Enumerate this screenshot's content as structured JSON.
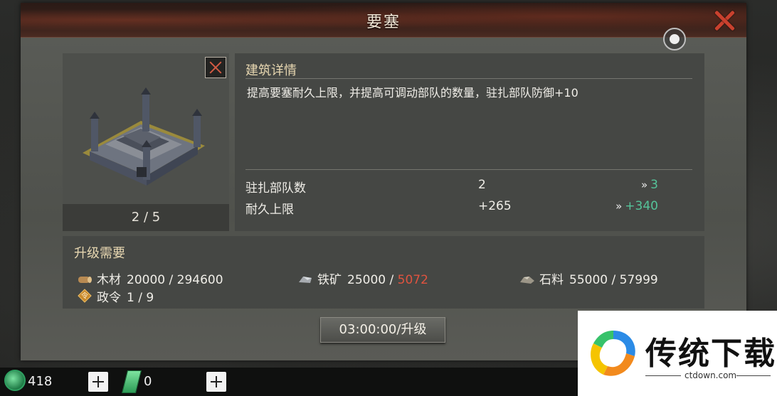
{
  "window": {
    "title": "要塞"
  },
  "building": {
    "level_text": "2 / 5"
  },
  "details": {
    "header": "建筑详情",
    "description": "提高要塞耐久上限，并提高可调动部队的数量，驻扎部队防御+10",
    "stats": [
      {
        "label": "驻扎部队数",
        "current": "2",
        "next": "3"
      },
      {
        "label": "耐久上限",
        "current": "+265",
        "next": "+340"
      }
    ]
  },
  "requirements": {
    "title": "升级需要",
    "items": [
      {
        "icon": "wood-icon",
        "name": "木材",
        "required": "20000",
        "owned": "294600",
        "sufficient": true
      },
      {
        "icon": "iron-ore-icon",
        "name": "铁矿",
        "required": "25000",
        "owned": "5072",
        "sufficient": false
      },
      {
        "icon": "stone-icon",
        "name": "石料",
        "required": "55000",
        "owned": "57999",
        "sufficient": true
      },
      {
        "icon": "decree-icon",
        "name": "政令",
        "required": "1",
        "owned": "9",
        "sufficient": true
      }
    ]
  },
  "upgrade_button": {
    "label": "03:00:00/升级"
  },
  "bottom_bar": {
    "gem_count": "418",
    "jade_count": "0"
  },
  "watermark": {
    "brand": "传统下载",
    "url": "ctdown.com"
  },
  "colors": {
    "accent_green": "#55c49a",
    "warning_red": "#e0533f",
    "title_gold": "#e6d6b0"
  }
}
